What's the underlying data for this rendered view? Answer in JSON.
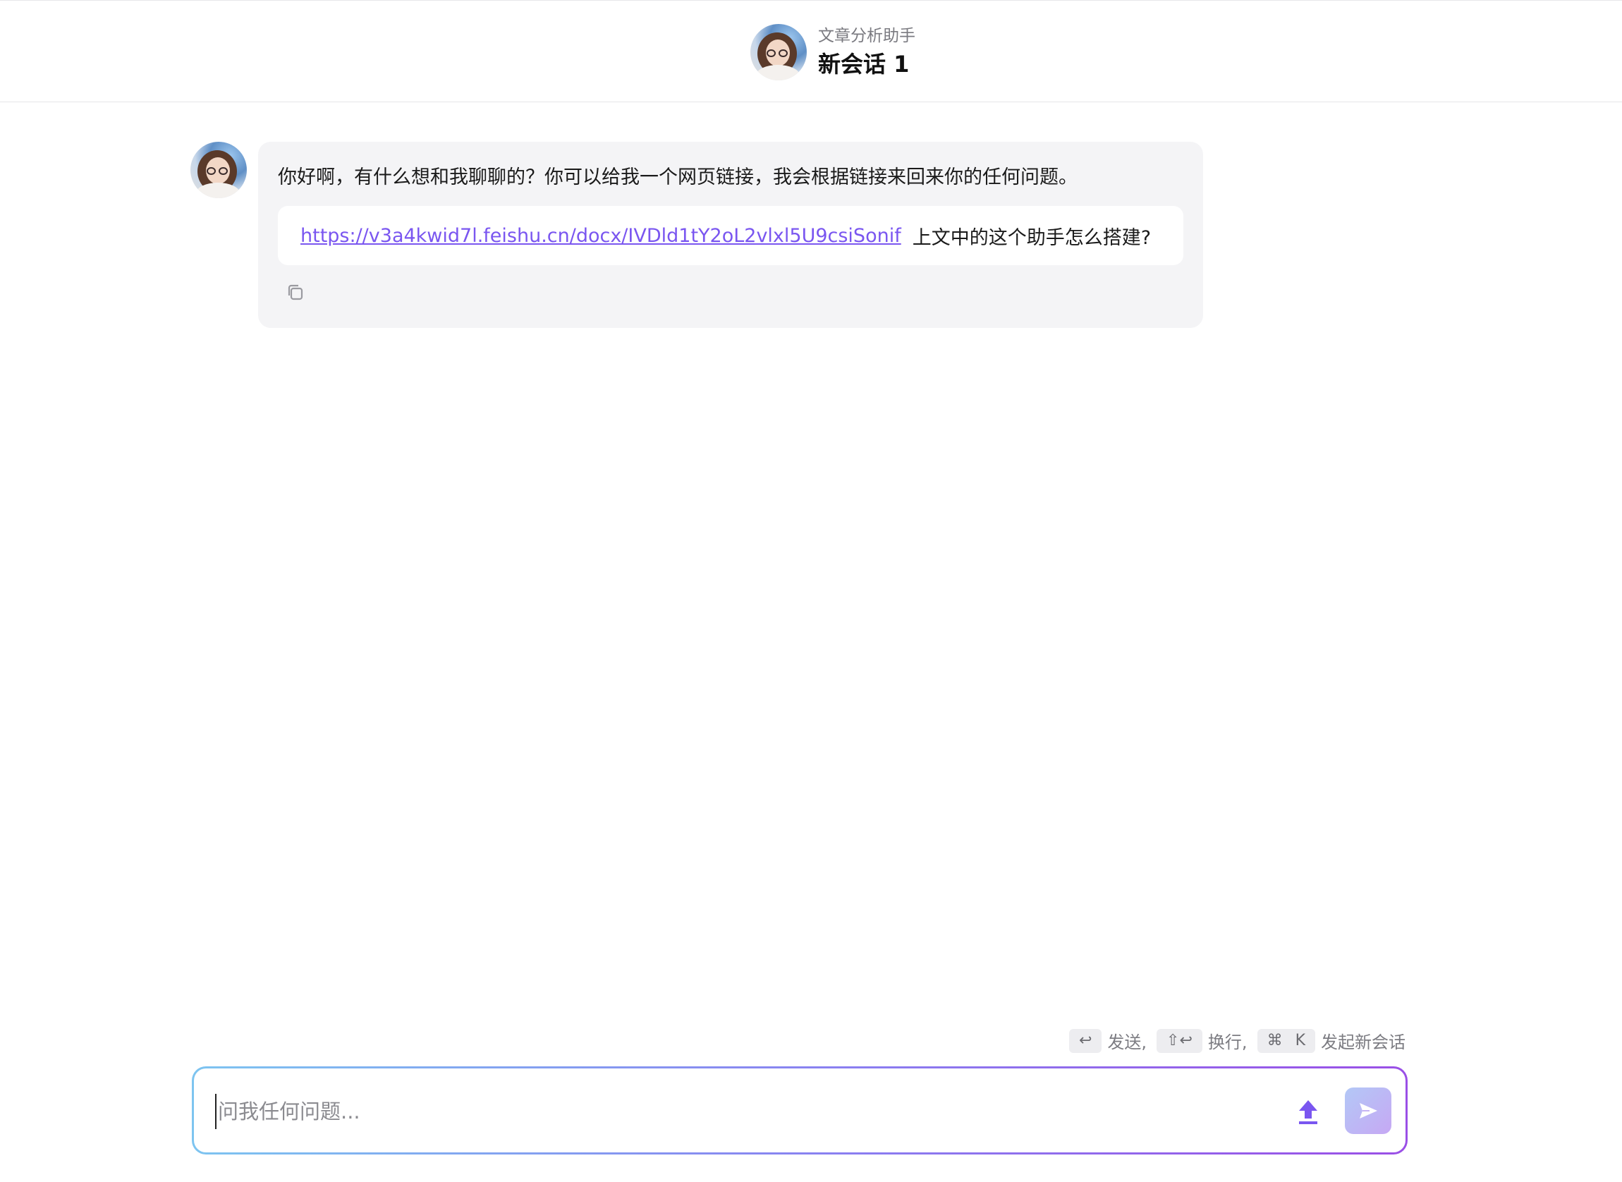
{
  "header": {
    "assistant_name": "文章分析助手",
    "conversation_title": "新会话 1"
  },
  "message": {
    "text": "你好啊，有什么想和我聊聊的？你可以给我一个网页链接，我会根据链接来回来你的任何问题。",
    "suggestion": {
      "link": "https://v3a4kwid7l.feishu.cn/docx/IVDld1tY2oL2vlxl5U9csiSonif",
      "question": "上文中的这个助手怎么搭建?"
    }
  },
  "hints": {
    "send_key": "↩",
    "send_label": "发送,",
    "newline_key": "⇧↩",
    "newline_label": "换行,",
    "new_chat_key_1": "⌘",
    "new_chat_key_2": "K",
    "new_chat_label": "发起新会话"
  },
  "input": {
    "placeholder": "问我任何问题..."
  },
  "colors": {
    "accent": "#7a56f0",
    "bubble_bg": "#f4f4f6",
    "border_gradient_start": "#7dc4f0",
    "border_gradient_end": "#9a4fe6"
  },
  "icons": {
    "copy": "copy-icon",
    "upload": "upload-icon",
    "send": "send-icon"
  }
}
